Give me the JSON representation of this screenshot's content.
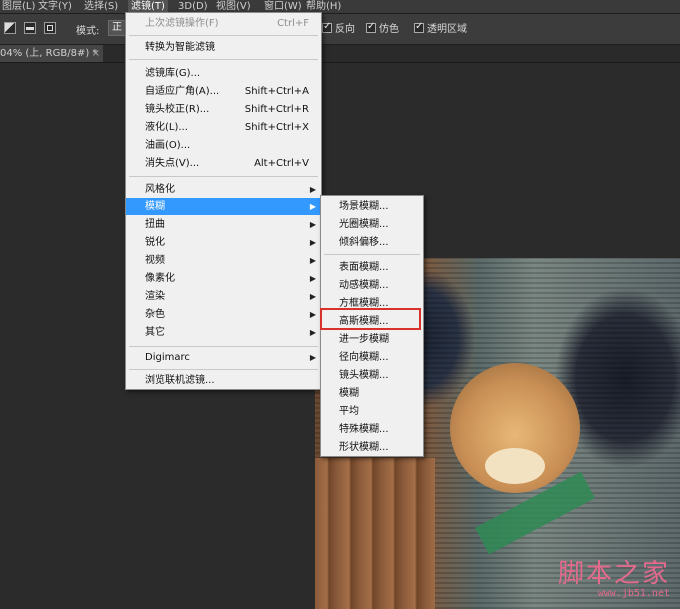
{
  "menubar": {
    "items": [
      {
        "label": "图层(L)"
      },
      {
        "label": "文字(Y)"
      },
      {
        "label": "选择(S)"
      },
      {
        "label": "滤镜(T)",
        "active": true
      },
      {
        "label": "3D(D)"
      },
      {
        "label": "视图(V)"
      },
      {
        "label": "窗口(W)"
      },
      {
        "label": "帮助(H)"
      }
    ]
  },
  "options": {
    "mode_label": "模式:",
    "mode_value": "正",
    "reverse_label": "反向",
    "dither_label": "仿色",
    "transparency_label": "透明区域",
    "reverse_checked": true,
    "dither_checked": true,
    "transparency_checked": true
  },
  "document": {
    "tab_label": "04% (上, RGB/8#) *",
    "close_glyph": "×"
  },
  "filter_menu": {
    "last_filter": {
      "label": "上次滤镜操作(F)",
      "shortcut": "Ctrl+F"
    },
    "convert_smart": "转换为智能滤镜",
    "gallery": "滤镜库(G)...",
    "adaptive_wide": {
      "label": "自适应广角(A)...",
      "shortcut": "Shift+Ctrl+A"
    },
    "lens_correction": {
      "label": "镜头校正(R)...",
      "shortcut": "Shift+Ctrl+R"
    },
    "liquify": {
      "label": "液化(L)...",
      "shortcut": "Shift+Ctrl+X"
    },
    "oil_paint": "油画(O)...",
    "vanishing_point": {
      "label": "消失点(V)...",
      "shortcut": "Alt+Ctrl+V"
    },
    "stylize": "风格化",
    "blur": "模糊",
    "distort": "扭曲",
    "sharpen": "锐化",
    "video": "视频",
    "pixelate": "像素化",
    "render": "渲染",
    "noise": "杂色",
    "other": "其它",
    "digimarc": "Digimarc",
    "browse_online": "浏览联机滤镜...",
    "arrow_glyph": "▶"
  },
  "blur_submenu": {
    "field_blur": "场景模糊...",
    "iris_blur": "光圈模糊...",
    "tilt_shift": "倾斜偏移...",
    "surface_blur": "表面模糊...",
    "motion_blur": "动感模糊...",
    "box_blur": "方框模糊...",
    "gaussian_blur": "高斯模糊...",
    "blur_more": "进一步模糊",
    "radial_blur": "径向模糊...",
    "lens_blur": "镜头模糊...",
    "blur": "模糊",
    "average": "平均",
    "smart_blur": "特殊模糊...",
    "shape_blur": "形状模糊..."
  },
  "watermark": {
    "title": "脚本之家",
    "url": "www.jb51.net"
  },
  "colors": {
    "highlight": "#3399ff",
    "annotation": "#d9302b",
    "watermark": "#e36a8d"
  }
}
